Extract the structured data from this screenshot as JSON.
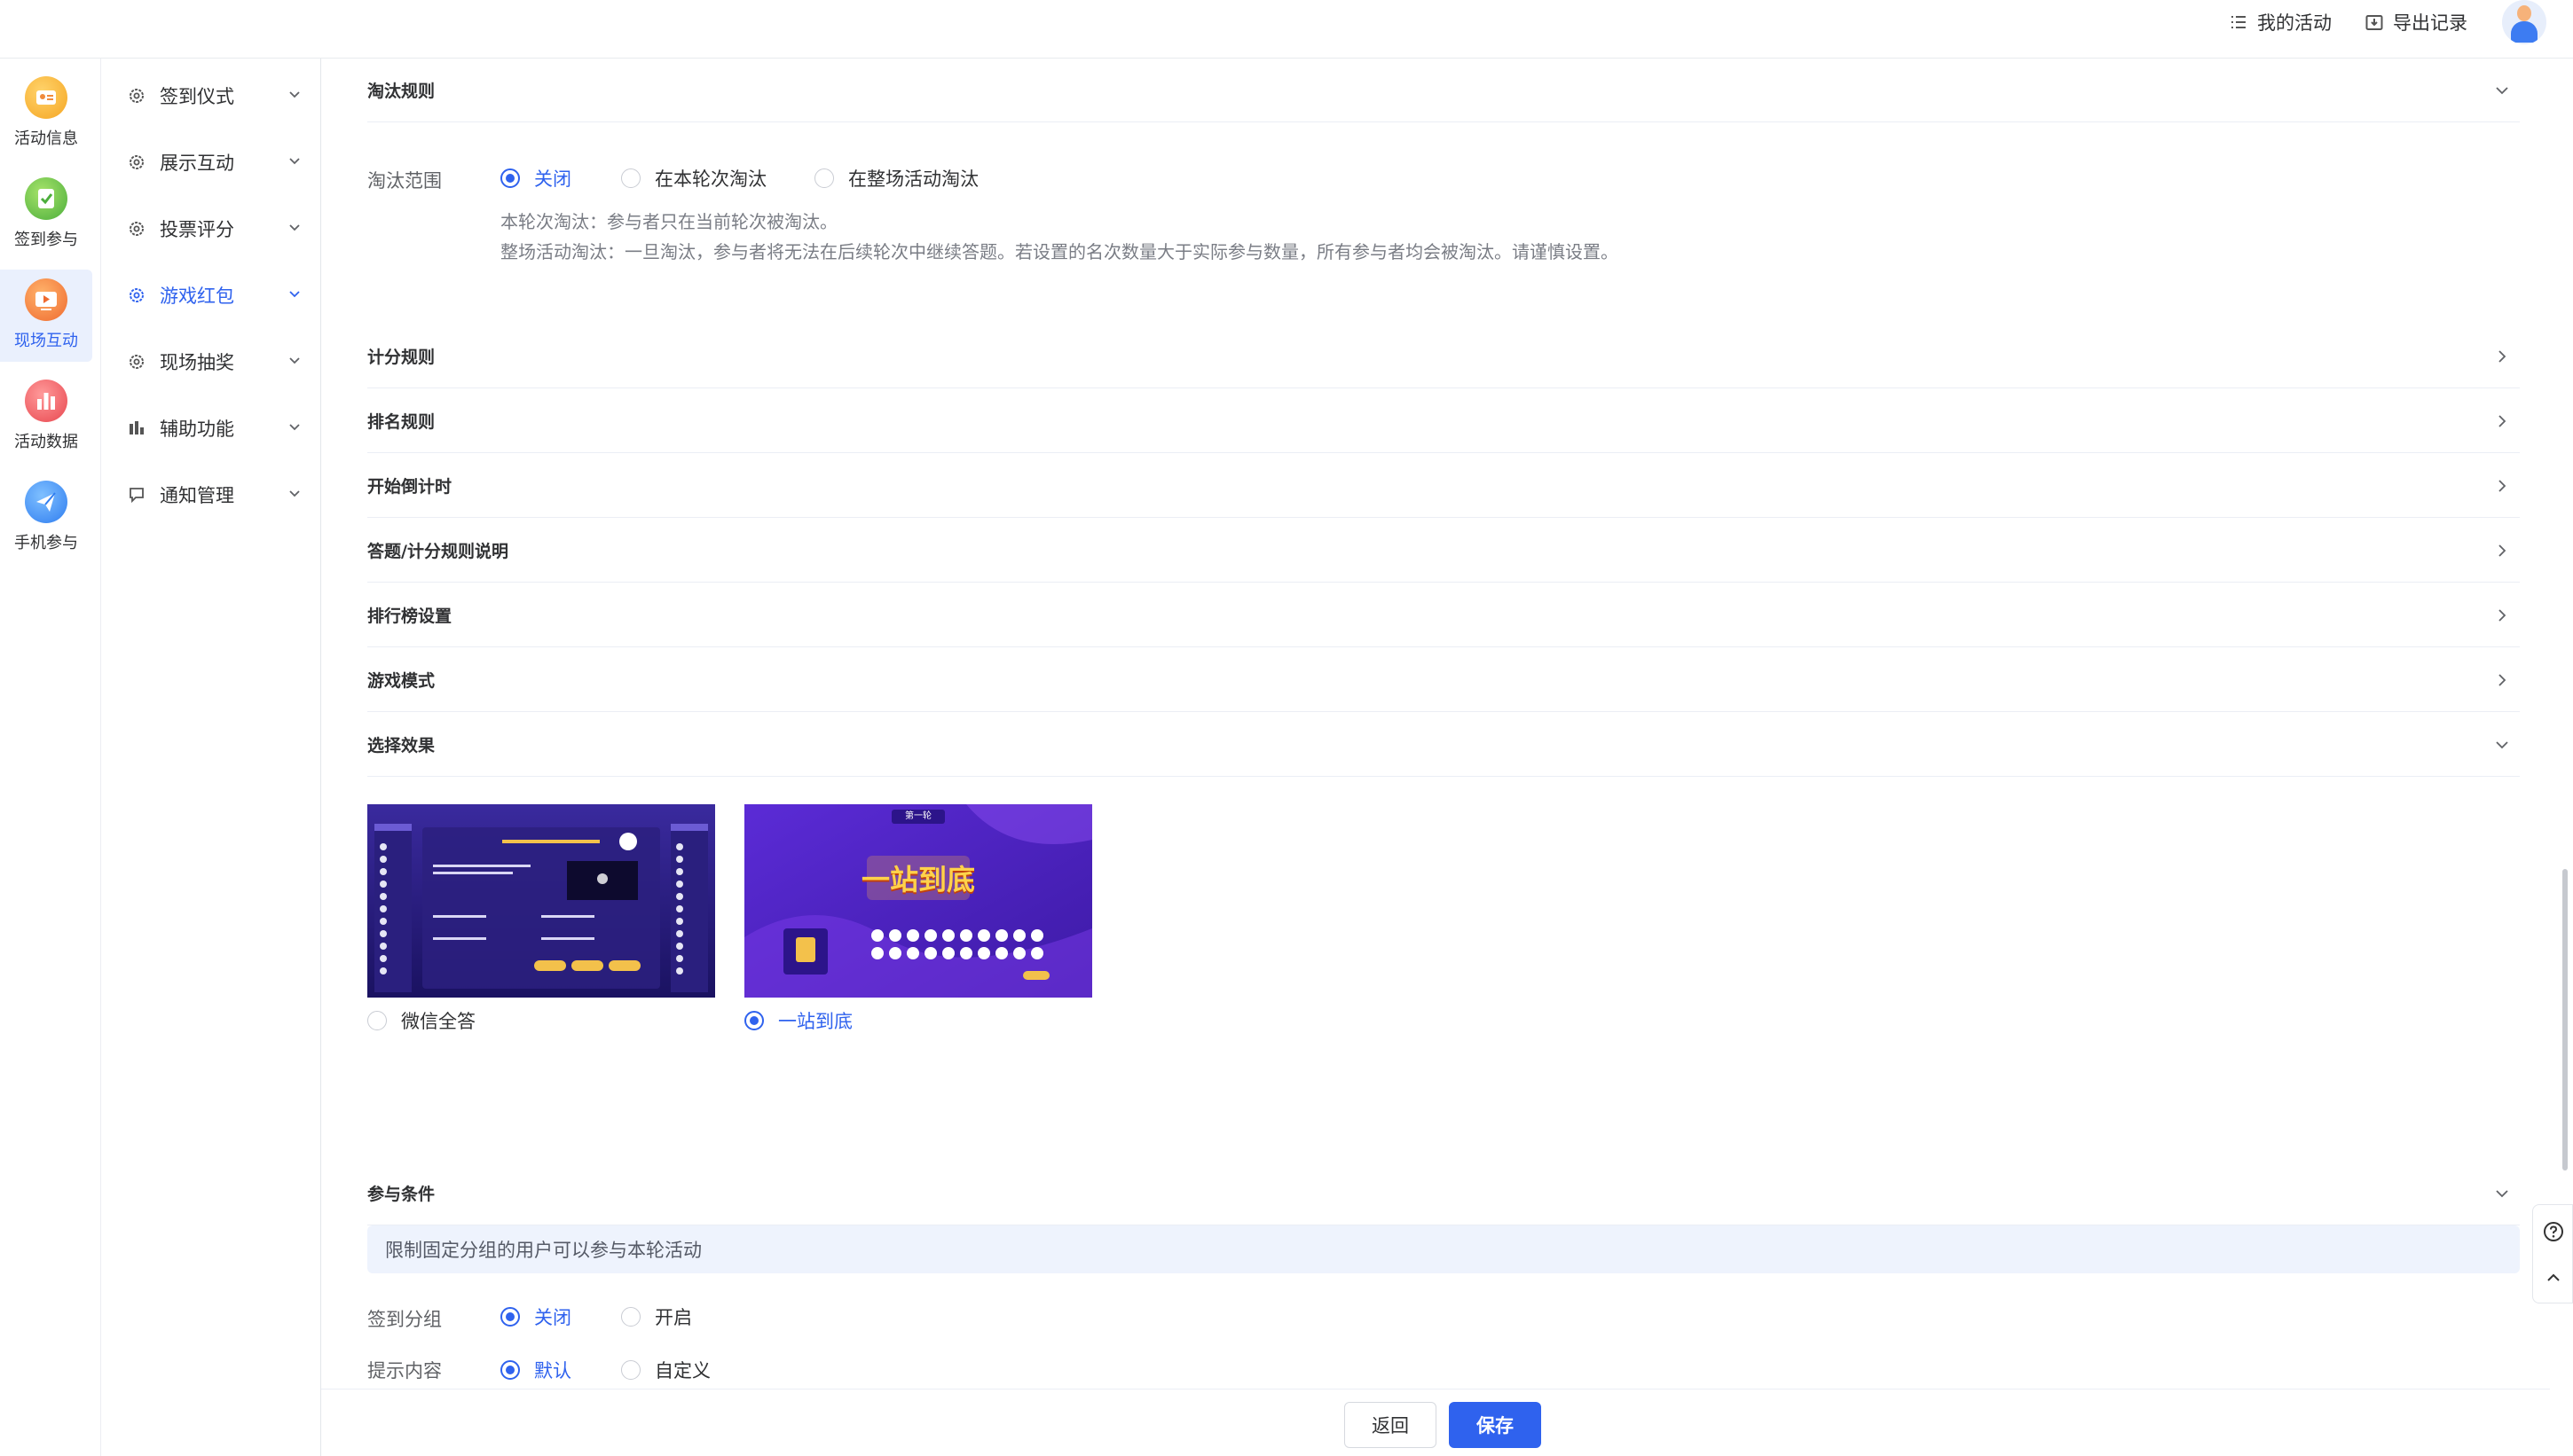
{
  "header": {
    "my_activities": "我的活动",
    "export_records": "导出记录"
  },
  "nav_primary": {
    "items": [
      {
        "label": "活动信息",
        "icon": "activity-info-icon"
      },
      {
        "label": "签到参与",
        "icon": "checkin-icon"
      },
      {
        "label": "现场互动",
        "icon": "live-interaction-icon",
        "active": true
      },
      {
        "label": "活动数据",
        "icon": "activity-data-icon"
      },
      {
        "label": "手机参与",
        "icon": "mobile-participation-icon"
      }
    ]
  },
  "nav_secondary": {
    "items": [
      {
        "label": "签到仪式",
        "icon": "gear-icon"
      },
      {
        "label": "展示互动",
        "icon": "gear-icon"
      },
      {
        "label": "投票评分",
        "icon": "gear-icon"
      },
      {
        "label": "游戏红包",
        "icon": "gear-icon",
        "active": true
      },
      {
        "label": "现场抽奖",
        "icon": "gear-icon"
      },
      {
        "label": "辅助功能",
        "icon": "bar-chart-icon"
      },
      {
        "label": "通知管理",
        "icon": "notification-icon"
      }
    ]
  },
  "elimination": {
    "title": "淘汰规则",
    "range_label": "淘汰范围",
    "options": [
      "关闭",
      "在本轮次淘汰",
      "在整场活动淘汰"
    ],
    "selected": "关闭",
    "hint1": "本轮次淘汰：参与者只在当前轮次被淘汰。",
    "hint2": "整场活动淘汰：一旦淘汰，参与者将无法在后续轮次中继续答题。若设置的名次数量大于实际参与数量，所有参与者均会被淘汰。请谨慎设置。"
  },
  "collapsed_sections": [
    "计分规则",
    "排名规则",
    "开始倒计时",
    "答题/计分规则说明",
    "排行榜设置",
    "游戏模式"
  ],
  "effect": {
    "title": "选择效果",
    "options": [
      "微信全答",
      "一站到底"
    ],
    "selected": "一站到底",
    "preview2_banner": "一站到底",
    "preview2_round": "第一轮"
  },
  "participation": {
    "title": "参与条件",
    "info": "限制固定分组的用户可以参与本轮活动",
    "group_label": "签到分组",
    "group_options": [
      "关闭",
      "开启"
    ],
    "group_selected": "关闭",
    "prompt_label": "提示内容",
    "prompt_options": [
      "默认",
      "自定义"
    ],
    "prompt_selected": "默认"
  },
  "actions": {
    "back": "返回",
    "save": "保存"
  },
  "colors": {
    "primary": "#2f62ee",
    "info_bg": "#eef3fd"
  }
}
